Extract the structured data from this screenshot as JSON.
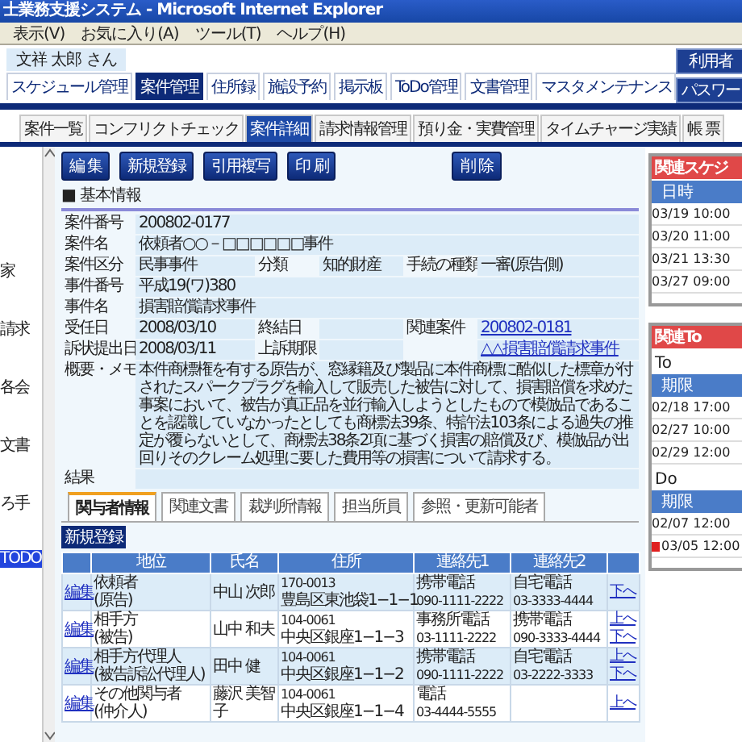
{
  "window": {
    "title": "士業務支援システム - Microsoft Internet Explorer"
  },
  "menu": [
    "表示(V)",
    "お気に入り(A)",
    "ツール(T)",
    "ヘルプ(H)"
  ],
  "user": "文祥 太郎 さん",
  "header_buttons": [
    "利用者",
    "パスワー"
  ],
  "main_tabs": [
    {
      "label": "スケジュール管理",
      "selected": false
    },
    {
      "label": "案件管理",
      "selected": true
    },
    {
      "label": "住所録",
      "selected": false
    },
    {
      "label": "施設予約",
      "selected": false
    },
    {
      "label": "掲示板",
      "selected": false
    },
    {
      "label": "ToDo管理",
      "selected": false
    },
    {
      "label": "文書管理",
      "selected": false
    },
    {
      "label": "マスタメンテナンス",
      "selected": false
    }
  ],
  "sub_tabs": [
    {
      "label": "案件一覧",
      "selected": false
    },
    {
      "label": "コンフリクトチェック",
      "selected": false
    },
    {
      "label": "案件詳細",
      "selected": true
    },
    {
      "label": "請求情報管理",
      "selected": false
    },
    {
      "label": "預り金・実費管理",
      "selected": false
    },
    {
      "label": "タイムチャージ実績",
      "selected": false
    },
    {
      "label": "帳 票",
      "selected": false
    }
  ],
  "sidebar": {
    "items": [
      {
        "label": "家",
        "selected": false
      },
      {
        "label": "請求",
        "selected": false
      },
      {
        "label": "各会",
        "selected": false
      },
      {
        "label": "文書",
        "selected": false
      },
      {
        "label": "ろ手",
        "selected": false
      },
      {
        "label": "TODO",
        "selected": true
      }
    ]
  },
  "actions": [
    "編 集",
    "新規登録",
    "引用複写",
    "印 刷"
  ],
  "delete_button": "削 除",
  "section_title": "■ 基本情報",
  "fields": [
    {
      "kind": "pairs",
      "items": [
        {
          "label": "案件番号",
          "value": "200802-0177"
        }
      ]
    },
    {
      "kind": "pairs",
      "items": [
        {
          "label": "案件名",
          "value": "依頼者○○－□□□□□□事件"
        }
      ]
    },
    {
      "kind": "pairs",
      "items": [
        {
          "label": "案件区分",
          "value": "民事事件"
        },
        {
          "label": "分類",
          "value": "知的財産"
        },
        {
          "label": "手続の種類",
          "value": "一審(原告側)"
        }
      ]
    },
    {
      "kind": "pairs",
      "items": [
        {
          "label": "事件番号",
          "value": "平成19(ワ)380"
        }
      ]
    },
    {
      "kind": "pairs",
      "items": [
        {
          "label": "事件名",
          "value": "損害賠償請求事件"
        }
      ]
    },
    {
      "kind": "pairs",
      "items": [
        {
          "label": "受任日",
          "value": "2008/03/10"
        },
        {
          "label": "終結日"
        },
        {
          "label": "関連案件",
          "value": "200802-0181",
          "link": true
        }
      ]
    },
    {
      "kind": "pairs",
      "items": [
        {
          "label": "訴状提出日",
          "value": "2008/03/11"
        },
        {
          "label": "上訴期限"
        },
        {
          "value": "△△損害賠償請求事件",
          "link": true
        }
      ]
    },
    {
      "kind": "memo",
      "items": [
        {
          "label": "概要・メモ",
          "value": "本件商標権を有する原告が、窓縁籍及び製品に本件商標に酷似した標章が付されたスパークプラグを輸入して販売した被告に対して、損害賠償を求めた事案において、被告が真正品を並行輸入しようとしたもので模倣品であることを認識していなかったとしても商標法39条、特許法103条による過失の推定が覆らないとして、商標法38条2項に基づく損害の賠償及び、模倣品が出回りそのクレーム処理に要した費用等の損害について請求する。"
        }
      ]
    },
    {
      "kind": "pairs",
      "items": [
        {
          "label": "結果"
        }
      ]
    }
  ],
  "detail_tabs": [
    {
      "label": "関与者情報",
      "selected": true
    },
    {
      "label": "関連文書",
      "selected": false
    },
    {
      "label": "裁判所情報",
      "selected": false
    },
    {
      "label": "担当所員",
      "selected": false
    },
    {
      "label": "参照・更新可能者",
      "selected": false
    }
  ],
  "add_button": "新規登録",
  "parties": {
    "columns": [
      "地位",
      "氏名",
      "住所",
      "連絡先1",
      "連絡先2"
    ],
    "rows": [
      {
        "edit": "編集",
        "role": [
          "依頼者",
          "(原告)"
        ],
        "name": "中山 次郎",
        "address": [
          "170-0013",
          "豊島区東池袋1−1−1"
        ],
        "contact1": [
          "携帯電話",
          "090-1111-2222"
        ],
        "contact2": [
          "自宅電話",
          "03-3333-4444"
        ],
        "moves": [
          "下へ"
        ]
      },
      {
        "edit": "編集",
        "role": [
          "相手方",
          "(被告)"
        ],
        "name": "山中 和夫",
        "address": [
          "104-0061",
          "中央区銀座1−1−3"
        ],
        "contact1": [
          "事務所電話",
          "03-1111-2222"
        ],
        "contact2": [
          "携帯電話",
          "090-3333-4444"
        ],
        "moves": [
          "上へ",
          "下へ"
        ]
      },
      {
        "edit": "編集",
        "role": [
          "相手方代理人",
          "(被告訴訟代理人)"
        ],
        "name": "田中 健",
        "address": [
          "104-0061",
          "中央区銀座1−1−2"
        ],
        "contact1": [
          "携帯電話",
          "090-1111-2222"
        ],
        "contact2": [
          "自宅電話",
          "03-2222-3333"
        ],
        "moves": [
          "上へ",
          "下へ"
        ]
      },
      {
        "edit": "編集",
        "role": [
          "その他関与者",
          "(仲介人)"
        ],
        "name": "藤沢 美智子",
        "address": [
          "104-0061",
          "中央区銀座1−1−4"
        ],
        "contact1": [
          "電話",
          "03-4444-5555"
        ],
        "contact2": [],
        "moves": [
          "上へ"
        ]
      }
    ]
  },
  "schedule": {
    "title": "関連スケジ",
    "header": "日時",
    "rows": [
      "03/19 10:00",
      "03/20 11:00",
      "03/21 13:30",
      "03/27 09:00"
    ]
  },
  "todo": {
    "title": "関連To",
    "sections": [
      {
        "label": "To",
        "header": "期限",
        "rows": [
          {
            "time": "02/18 17:00",
            "overdue": false
          },
          {
            "time": "02/27 10:00",
            "overdue": false
          },
          {
            "time": "02/29 12:00",
            "overdue": false
          }
        ]
      },
      {
        "label": "Do",
        "header": "期限",
        "rows": [
          {
            "time": "02/07 12:00",
            "overdue": false
          },
          {
            "time": "03/05 12:00",
            "overdue": true
          }
        ]
      }
    ]
  }
}
